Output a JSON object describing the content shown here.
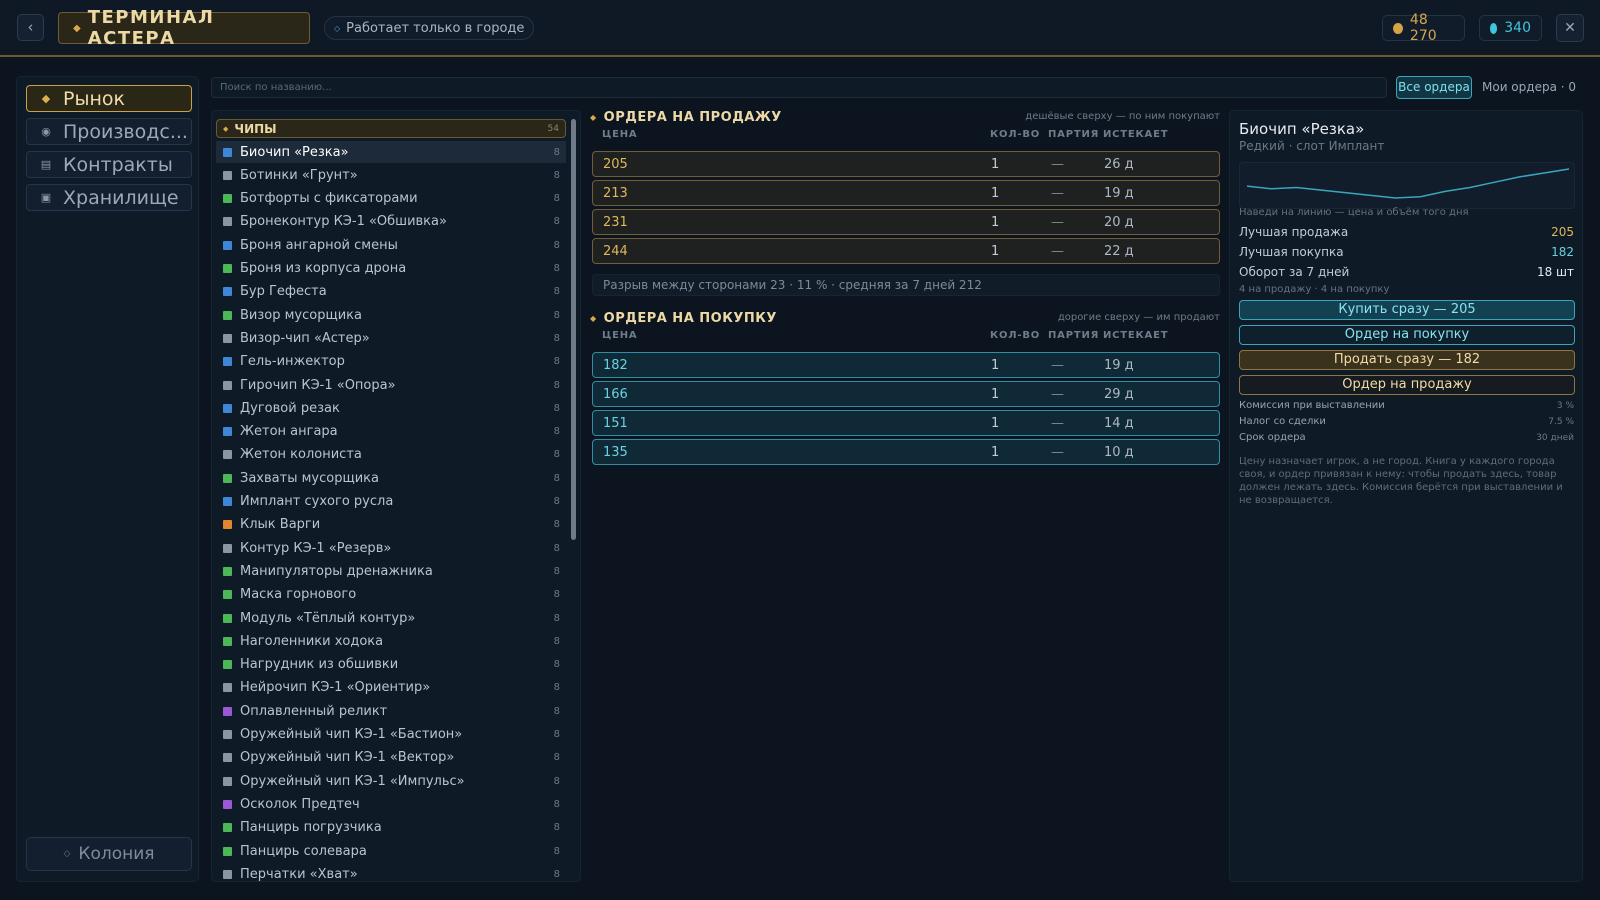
{
  "header": {
    "back_icon": "chevron-left-icon",
    "title": "ТЕРМИНАЛ АСТЕРА",
    "city_notice": "Работает только в городе",
    "currency_gold": "48 270",
    "currency_gems": "340",
    "colors": {
      "gold": "#d5a446",
      "gem": "#3cc7dc",
      "accent": "#c7a24b",
      "buy_accent": "#3aa6bb"
    }
  },
  "nav": {
    "items": [
      {
        "label": "Рынок",
        "icon": "diamond-icon"
      },
      {
        "label": "Производс...",
        "icon": "cog-icon"
      },
      {
        "label": "Контракты",
        "icon": "document-icon"
      },
      {
        "label": "Хранилище",
        "icon": "crate-icon"
      }
    ],
    "active": "Рынок",
    "colony_label": "Колония"
  },
  "search": {
    "placeholder": "Поиск по названию...",
    "all_orders": "Все ордера",
    "my_orders": "Мои ордера · 0"
  },
  "category": {
    "name": "ЧИПЫ",
    "count": "54"
  },
  "items": [
    {
      "name": "Биочип «Резка»",
      "qty": "8",
      "rarity": "blue"
    },
    {
      "name": "Ботинки «Грунт»",
      "qty": "8",
      "rarity": "grey"
    },
    {
      "name": "Ботфорты с фиксаторами",
      "qty": "8",
      "rarity": "green"
    },
    {
      "name": "Бронеконтур КЭ-1 «Обшивка»",
      "qty": "8",
      "rarity": "grey"
    },
    {
      "name": "Броня ангарной смены",
      "qty": "8",
      "rarity": "blue"
    },
    {
      "name": "Броня из корпуса дрона",
      "qty": "8",
      "rarity": "green"
    },
    {
      "name": "Бур Гефеста",
      "qty": "8",
      "rarity": "blue"
    },
    {
      "name": "Визор мусорщика",
      "qty": "8",
      "rarity": "green"
    },
    {
      "name": "Визор-чип «Астер»",
      "qty": "8",
      "rarity": "grey"
    },
    {
      "name": "Гель-инжектор",
      "qty": "8",
      "rarity": "blue"
    },
    {
      "name": "Гирочип КЭ-1 «Опора»",
      "qty": "8",
      "rarity": "grey"
    },
    {
      "name": "Дуговой резак",
      "qty": "8",
      "rarity": "blue"
    },
    {
      "name": "Жетон ангара",
      "qty": "8",
      "rarity": "blue"
    },
    {
      "name": "Жетон колониста",
      "qty": "8",
      "rarity": "grey"
    },
    {
      "name": "Захваты мусорщика",
      "qty": "8",
      "rarity": "green"
    },
    {
      "name": "Имплант сухого русла",
      "qty": "8",
      "rarity": "blue"
    },
    {
      "name": "Клык Варги",
      "qty": "8",
      "rarity": "orange"
    },
    {
      "name": "Контур КЭ-1 «Резерв»",
      "qty": "8",
      "rarity": "grey"
    },
    {
      "name": "Манипуляторы дренажника",
      "qty": "8",
      "rarity": "green"
    },
    {
      "name": "Маска горнового",
      "qty": "8",
      "rarity": "green"
    },
    {
      "name": "Модуль «Тёплый контур»",
      "qty": "8",
      "rarity": "green"
    },
    {
      "name": "Наголенники ходока",
      "qty": "8",
      "rarity": "green"
    },
    {
      "name": "Нагрудник из обшивки",
      "qty": "8",
      "rarity": "green"
    },
    {
      "name": "Нейрочип КЭ-1 «Ориентир»",
      "qty": "8",
      "rarity": "grey"
    },
    {
      "name": "Оплавленный реликт",
      "qty": "8",
      "rarity": "purple"
    },
    {
      "name": "Оружейный чип КЭ-1 «Бастион»",
      "qty": "8",
      "rarity": "grey"
    },
    {
      "name": "Оружейный чип КЭ-1 «Вектор»",
      "qty": "8",
      "rarity": "grey"
    },
    {
      "name": "Оружейный чип КЭ-1 «Импульс»",
      "qty": "8",
      "rarity": "grey"
    },
    {
      "name": "Осколок Предтеч",
      "qty": "8",
      "rarity": "purple"
    },
    {
      "name": "Панцирь погрузчика",
      "qty": "8",
      "rarity": "green"
    },
    {
      "name": "Панцирь солевара",
      "qty": "8",
      "rarity": "green"
    },
    {
      "name": "Перчатки «Хват»",
      "qty": "8",
      "rarity": "grey"
    }
  ],
  "sell_orders": {
    "title": "ОРДЕРА НА ПРОДАЖУ",
    "hint": "дешёвые сверху — по ним покупают",
    "columns": [
      "ЦЕНА",
      "КОЛ-ВО",
      "ПАРТИЯ",
      "ИСТЕКАЕТ"
    ],
    "rows": [
      {
        "price": "205",
        "qty": "1",
        "batch": "—",
        "expires": "26 д"
      },
      {
        "price": "213",
        "qty": "1",
        "batch": "—",
        "expires": "19 д"
      },
      {
        "price": "231",
        "qty": "1",
        "batch": "—",
        "expires": "20 д"
      },
      {
        "price": "244",
        "qty": "1",
        "batch": "—",
        "expires": "22 д"
      }
    ]
  },
  "spread": "Разрыв между сторонами  23 · 11 % · средняя за 7 дней 212",
  "buy_orders": {
    "title": "ОРДЕРА НА ПОКУПКУ",
    "hint": "дорогие сверху — им продают",
    "columns": [
      "ЦЕНА",
      "КОЛ-ВО",
      "ПАРТИЯ",
      "ИСТЕКАЕТ"
    ],
    "rows": [
      {
        "price": "182",
        "qty": "1",
        "batch": "—",
        "expires": "19 д"
      },
      {
        "price": "166",
        "qty": "1",
        "batch": "—",
        "expires": "29 д"
      },
      {
        "price": "151",
        "qty": "1",
        "batch": "—",
        "expires": "14 д"
      },
      {
        "price": "135",
        "qty": "1",
        "batch": "—",
        "expires": "10 д"
      }
    ]
  },
  "detail": {
    "name": "Биочип «Резка»",
    "subtitle": "Редкий · слот Имплант",
    "chart_hint": "Наведи на линию — цена и объём того дня",
    "best_sell_label": "Лучшая продажа",
    "best_sell": "205",
    "best_buy_label": "Лучшая покупка",
    "best_buy": "182",
    "volume_label": "Оборот за 7 дней",
    "volume": "18 шт",
    "orders_count": "4 на продажу · 4 на покупку",
    "buy_now": "Купить сразу — 205",
    "buy_order": "Ордер на покупку",
    "sell_now": "Продать сразу — 182",
    "sell_order": "Ордер на продажу",
    "fees": [
      {
        "label": "Комиссия при выставлении",
        "value": "3 %"
      },
      {
        "label": "Налог со сделки",
        "value": "7.5 %"
      },
      {
        "label": "Срок ордера",
        "value": "30 дней"
      }
    ],
    "note": "Цену назначает игрок, а не город. Книга у каждого города своя, и ордер привязан к нему: чтобы продать здесь, товар должен лежать здесь. Комиссия берётся при выставлении и не возвращается.",
    "price_history": [
      210,
      208,
      209,
      207,
      205,
      203,
      201,
      202,
      206,
      209,
      213,
      217,
      220,
      223
    ]
  }
}
